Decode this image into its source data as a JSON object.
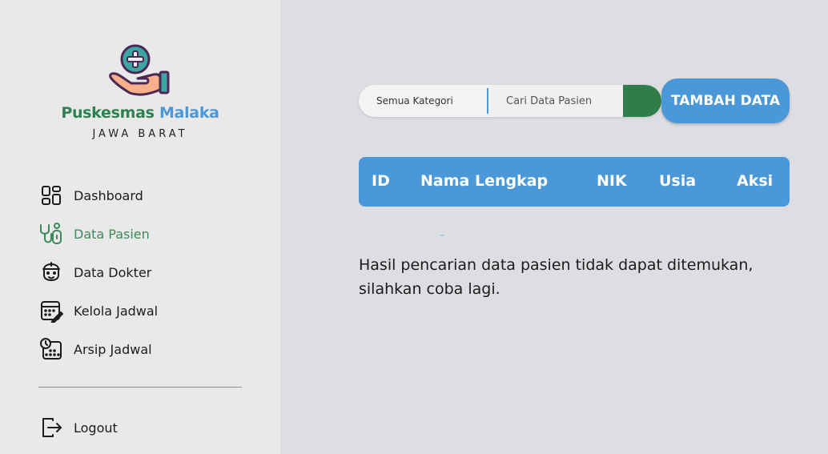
{
  "brand": {
    "name_part1": "Puskesmas",
    "name_part2": "Malaka",
    "subtitle": "JAWA BARAT",
    "colors": {
      "green": "#2e8150",
      "blue": "#4a98d8"
    }
  },
  "sidebar": {
    "items": [
      {
        "label": "Dashboard",
        "icon": "dashboard-icon",
        "active": false
      },
      {
        "label": "Data Pasien",
        "icon": "stethoscope-icon",
        "active": true
      },
      {
        "label": "Data Dokter",
        "icon": "doctor-icon",
        "active": false
      },
      {
        "label": "Kelola Jadwal",
        "icon": "calendar-edit-icon",
        "active": false
      },
      {
        "label": "Arsip Jadwal",
        "icon": "calendar-clock-icon",
        "active": false
      }
    ],
    "logout": {
      "label": "Logout",
      "icon": "logout-icon"
    }
  },
  "search": {
    "category": "Semua Kategori",
    "placeholder": "Cari Data Pasien",
    "value": ""
  },
  "actions": {
    "add_label": "TAMBAH DATA"
  },
  "table": {
    "columns": [
      "ID",
      "Nama Lengkap",
      "NIK",
      "Usia",
      "Aksi"
    ]
  },
  "empty_message": "Hasil pencarian data pasien tidak dapat ditemukan, silahkan coba lagi."
}
